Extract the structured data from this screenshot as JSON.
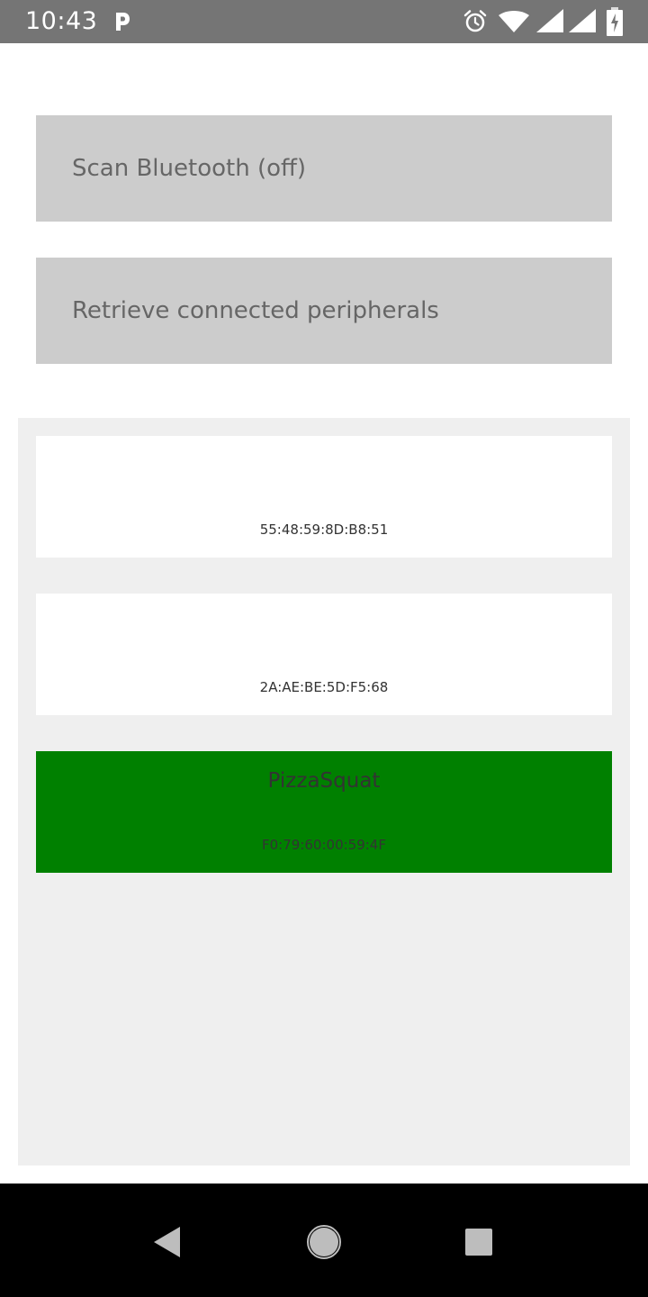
{
  "status_bar": {
    "time": "10:43",
    "icons": [
      "parking-app-icon",
      "alarm-icon",
      "wifi-icon",
      "signal-icon",
      "signal-icon",
      "battery-charging-icon"
    ]
  },
  "buttons": {
    "scan_label": "Scan Bluetooth (off)",
    "retrieve_label": "Retrieve connected peripherals"
  },
  "devices": [
    {
      "name": "",
      "id": "55:48:59:8D:B8:51",
      "connected": false
    },
    {
      "name": "",
      "id": "2A:AE:BE:5D:F5:68",
      "connected": false
    },
    {
      "name": "PizzaSquat",
      "id": "F0:79:60:00:59:4F",
      "connected": true
    }
  ],
  "colors": {
    "status_bar": "#757575",
    "button_bg": "#cccccc",
    "list_bg": "#efefef",
    "connected_row": "#008000",
    "nav_bar": "#000000"
  },
  "nav": {
    "icons": [
      "back-icon",
      "home-icon",
      "recents-icon"
    ]
  }
}
